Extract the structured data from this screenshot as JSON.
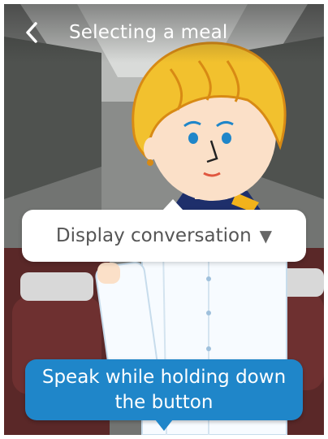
{
  "header": {
    "back_icon": "chevron-left-icon",
    "title": "Selecting a meal"
  },
  "conversation_toggle": {
    "label": "Display conversation",
    "arrow": "▼"
  },
  "speak_button": {
    "line1": "Speak while holding down",
    "line2": "the button"
  },
  "colors": {
    "accent_blue": "#1f86c9",
    "hair": "#f2c12e",
    "skin": "#fbe0c8",
    "uniform_navy": "#1e2f6b"
  }
}
